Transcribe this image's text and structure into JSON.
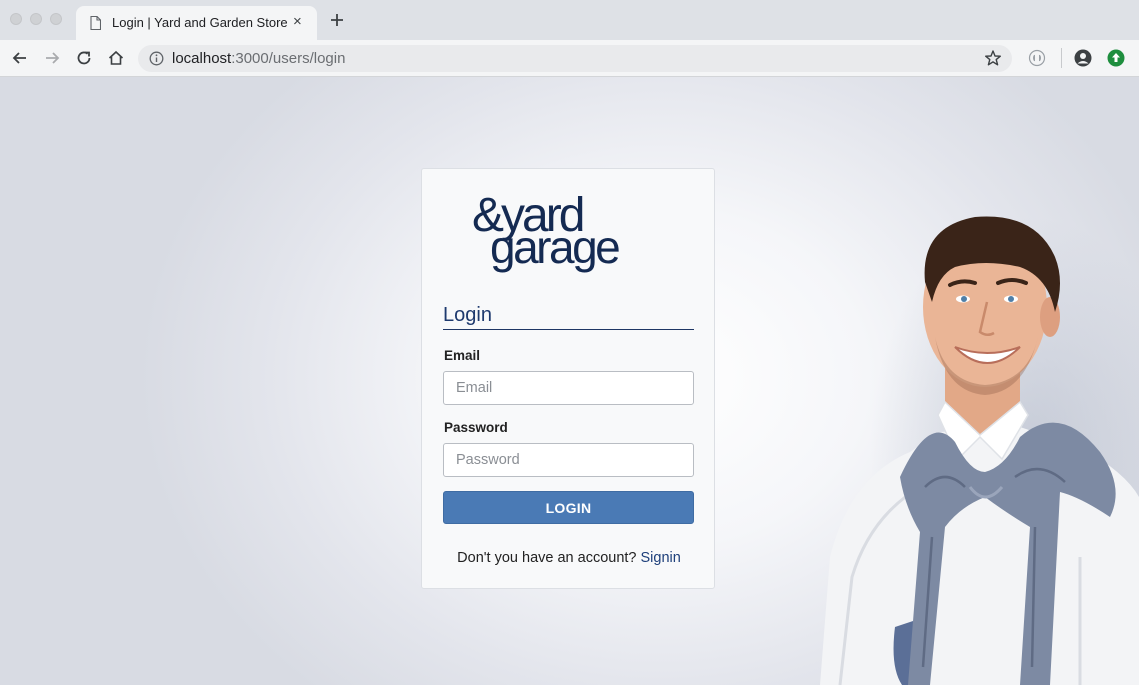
{
  "browser": {
    "tab": {
      "title": "Login | Yard and Garden Store",
      "close_glyph": "×"
    },
    "newtab_glyph": "+",
    "url_host": "localhost",
    "url_path": ":3000/users/login"
  },
  "logo": {
    "line1": "&yard",
    "line2": "garage"
  },
  "login": {
    "heading": "Login",
    "email_label": "Email",
    "email_placeholder": "Email",
    "password_label": "Password",
    "password_placeholder": "Password",
    "submit_label": "LOGIN",
    "signup_prompt": "Don't you have an account?",
    "signup_link": "Signin"
  },
  "colors": {
    "brand": "#142a52",
    "button": "#4a7ab5"
  },
  "icons": [
    "document-icon",
    "back-arrow-icon",
    "forward-arrow-icon",
    "reload-icon",
    "home-icon",
    "info-icon",
    "bookmark-star-icon",
    "extension-icon",
    "profile-icon",
    "update-icon"
  ]
}
